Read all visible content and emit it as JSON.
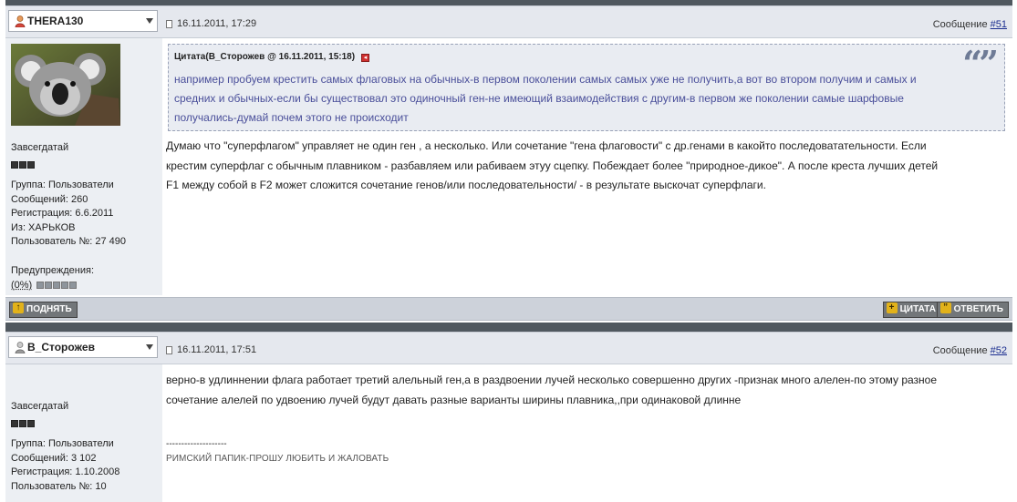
{
  "posts": [
    {
      "author": "THERA130",
      "date": "16.11.2011, 17:29",
      "msg_label": "Сообщение",
      "msg_num": "#51",
      "rank": "Завсегдатай",
      "info": {
        "group": "Группа: Пользователи",
        "messages": "Сообщений: 260",
        "registered": "Регистрация: 6.6.2011",
        "from": "Из: ХАРЬКОВ",
        "user_no": "Пользователь №: 27 490"
      },
      "warnings_label": "Предупреждения:",
      "warnings_value": "(0%)",
      "quote": {
        "header": "Цитата(В_Сторожев @ 16.11.2011, 15:18)",
        "lines": [
          "например пробуем крестить самых флаговых на обычных-в первом поколении самых самых уже не получить,а вот во втором получим и самых и",
          "средних и обычных-если бы существовал это одиночный ген-не имеющий взаимодействия с другим-в первом же поколении самые шарфовые",
          "получались-думай почем этого не происходит"
        ]
      },
      "text_lines": [
        "Думаю что \"суперфлагом\" управляет не один ген , а несколько. Или сочетание \"гена флаговости\" с др.генами в какойто последоватательности. Если",
        "крестим суперфлаг с обычным плавником - разбавляем или рабиваем этуу сцепку. Побеждает более \"природное-дикое\". А после креста лучших детей",
        "F1 между собой в F2 может сложится сочетание генов/или последовательности/ - в результате выскочат суперфлаги."
      ],
      "buttons": {
        "up": "ПОДНЯТЬ",
        "quote": "ЦИТАТА",
        "reply": "ОТВЕТИТЬ"
      }
    },
    {
      "author": "В_Сторожев",
      "date": "16.11.2011, 17:51",
      "msg_label": "Сообщение",
      "msg_num": "#52",
      "rank": "Завсегдатай",
      "info": {
        "group": "Группа: Пользователи",
        "messages": "Сообщений: 3 102",
        "registered": "Регистрация: 1.10.2008",
        "user_no": "Пользователь №: 10"
      },
      "text_lines": [
        "верно-в удлиннении флага работает третий алельный ген,а в раздвоении лучей несколько совершенно других -признак много алелен-по этому разное",
        "сочетание алелей по удвоению лучей будут давать разные варианты ширины плавника,,при одинаковой длинне"
      ],
      "sig_sep": "--------------------",
      "signature": "РИМСКИЙ ПАПИК-ПРОШУ ЛЮБИТЬ И ЖАЛОВАТЬ"
    }
  ],
  "icons": {
    "user": "user-icon",
    "date": "document-icon",
    "quote_mark": "quote-icon",
    "jump": "jump-to-post-icon"
  }
}
